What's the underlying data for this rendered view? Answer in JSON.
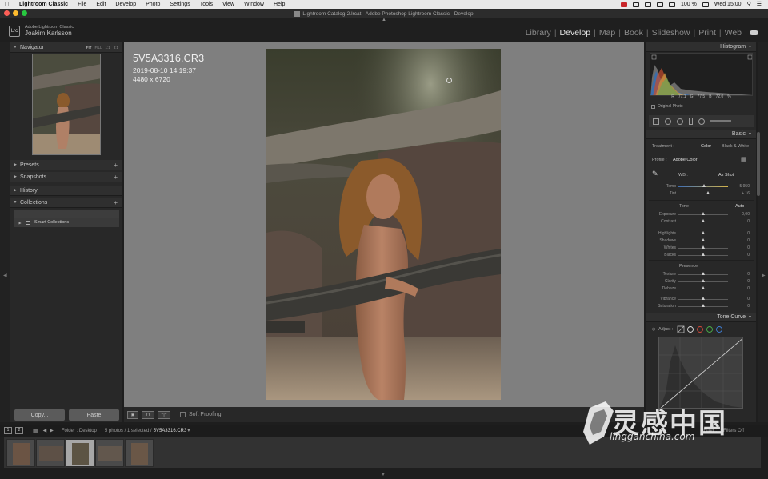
{
  "menubar": {
    "items": [
      "Lightroom Classic",
      "File",
      "Edit",
      "Develop",
      "Photo",
      "Settings",
      "Tools",
      "View",
      "Window",
      "Help"
    ],
    "battery": "100 %",
    "clock": "Wed 15:00"
  },
  "window": {
    "title": "Lightroom Catalog-2.lrcat - Adobe Photoshop Lightroom Classic - Develop"
  },
  "identity": {
    "badge": "Lrc",
    "line1": "Adobe Lightroom Classic",
    "user": "Joakim Karlsson"
  },
  "modules": [
    "Library",
    "Develop",
    "Map",
    "Book",
    "Slideshow",
    "Print",
    "Web"
  ],
  "left": {
    "navigator": "Navigator",
    "nav_modes": [
      "FIT",
      "FILL",
      "1:1",
      "3:1"
    ],
    "presets": "Presets",
    "snapshots": "Snapshots",
    "history": "History",
    "collections": "Collections",
    "smart_collections": "Smart Collections",
    "copy_button": "Copy...",
    "paste_button": "Paste"
  },
  "photo_info": {
    "filename": "5V5A3316.CR3",
    "datetime": "2019-08-10 14:19:37",
    "dimensions": "4480 x 6720"
  },
  "toolbar": {
    "soft_proofing": "Soft Proofing"
  },
  "right": {
    "histogram": "Histogram",
    "r_label": "R",
    "r_value": "77,1",
    "g_label": "G",
    "g_value": "77,5",
    "b_label": "B",
    "b_value": "72,0",
    "pct": "%",
    "original_photo": "Original Photo",
    "basic": "Basic",
    "treatment_label": "Treatment :",
    "treatment_color": "Color",
    "treatment_bw": "Black & White",
    "profile_label": "Profile :",
    "profile_value": "Adobe Color",
    "wb_label": "WB :",
    "wb_value": "As Shot",
    "tone_label": "Tone",
    "auto": "Auto",
    "presence_label": "Presence",
    "tone_curve": "Tone Curve",
    "adjust": "Adjust :",
    "sliders": [
      {
        "label": "Temp",
        "value": "5 950",
        "pos": 0.52
      },
      {
        "label": "Tint",
        "value": "+ 16",
        "pos": 0.6
      },
      {
        "label": "Exposure",
        "value": "0,00",
        "pos": 0.5
      },
      {
        "label": "Contrast",
        "value": "0",
        "pos": 0.5
      },
      {
        "label": "Highlights",
        "value": "0",
        "pos": 0.5
      },
      {
        "label": "Shadows",
        "value": "0",
        "pos": 0.5
      },
      {
        "label": "Whites",
        "value": "0",
        "pos": 0.5
      },
      {
        "label": "Blacks",
        "value": "0",
        "pos": 0.5
      },
      {
        "label": "Texture",
        "value": "0",
        "pos": 0.5
      },
      {
        "label": "Clarity",
        "value": "0",
        "pos": 0.5
      },
      {
        "label": "Dehaze",
        "value": "0",
        "pos": 0.5
      },
      {
        "label": "Vibrance",
        "value": "0",
        "pos": 0.5
      },
      {
        "label": "Saturation",
        "value": "0",
        "pos": 0.5
      }
    ]
  },
  "filmstrip": {
    "page1": "1",
    "page2": "2",
    "folder": "Folder : Desktop",
    "count": "5 photos / 1 selected /",
    "selected": "5V5A3316.CR3",
    "filter": "Filter :",
    "filters_off": "Filters Off"
  },
  "watermark": {
    "text": "灵感中国",
    "url": "lingganchina.com"
  }
}
